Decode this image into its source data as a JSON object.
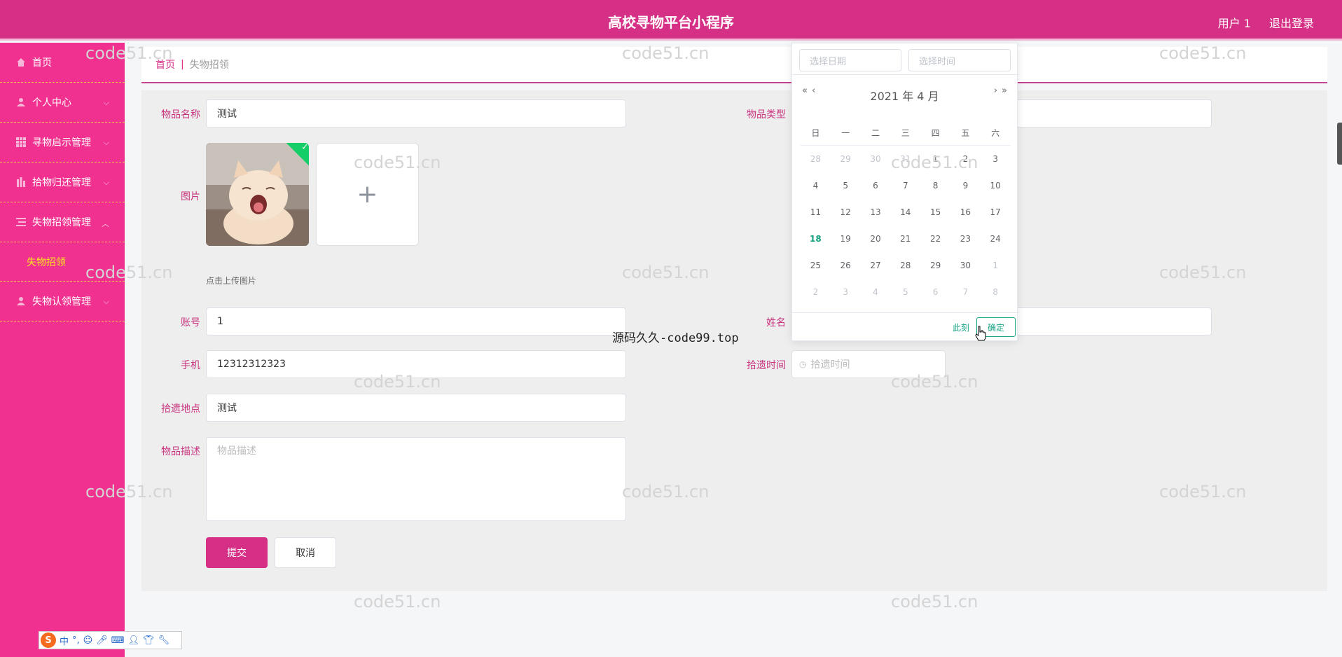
{
  "header": {
    "title": "高校寻物平台小程序",
    "user": "用户 1",
    "logout": "退出登录"
  },
  "sidebar": {
    "items": [
      {
        "label": "首页",
        "icon": "home-icon"
      },
      {
        "label": "个人中心",
        "icon": "user-icon"
      },
      {
        "label": "寻物启示管理",
        "icon": "grid-icon"
      },
      {
        "label": "拾物归还管理",
        "icon": "chart-icon"
      },
      {
        "label": "失物招领管理",
        "icon": "list-icon"
      },
      {
        "label": "失物认领管理",
        "icon": "user-icon"
      }
    ],
    "submenu": "失物招领"
  },
  "breadcrumb": {
    "home": "首页",
    "separator": "|",
    "current": "失物招领"
  },
  "form": {
    "name_label": "物品名称",
    "name_value": "测试",
    "type_label": "物品类型",
    "image_label": "图片",
    "upload_hint": "点击上传图片",
    "account_label": "账号",
    "account_value": "1",
    "realname_label": "姓名",
    "phone_label": "手机",
    "phone_value": "12312312323",
    "time_label": "拾遗时间",
    "time_placeholder": "拾遗时间",
    "place_label": "拾遗地点",
    "place_value": "测试",
    "desc_label": "物品描述",
    "desc_placeholder": "物品描述",
    "submit": "提交",
    "cancel": "取消"
  },
  "datepicker": {
    "date_placeholder": "选择日期",
    "time_placeholder": "选择时间",
    "title": "2021 年  4 月",
    "weekdays": [
      "日",
      "一",
      "二",
      "三",
      "四",
      "五",
      "六"
    ],
    "weeks": [
      [
        "28",
        "29",
        "30",
        "31",
        "1",
        "2",
        "3"
      ],
      [
        "4",
        "5",
        "6",
        "7",
        "8",
        "9",
        "10"
      ],
      [
        "11",
        "12",
        "13",
        "14",
        "15",
        "16",
        "17"
      ],
      [
        "18",
        "19",
        "20",
        "21",
        "22",
        "23",
        "24"
      ],
      [
        "25",
        "26",
        "27",
        "28",
        "29",
        "30",
        "1"
      ],
      [
        "2",
        "3",
        "4",
        "5",
        "6",
        "7",
        "8"
      ]
    ],
    "today": "18",
    "now": "此刻",
    "ok": "确定"
  },
  "watermark": "code51.cn",
  "overlay": "源码久久-code99.top",
  "ime": {
    "logo": "S",
    "lang": "中",
    "punct": "°,"
  },
  "colors": {
    "primary": "#d52f86",
    "sidebar": "#f0318f",
    "accent_yellow": "#f7e31f",
    "picker_accent": "#1aa586"
  }
}
